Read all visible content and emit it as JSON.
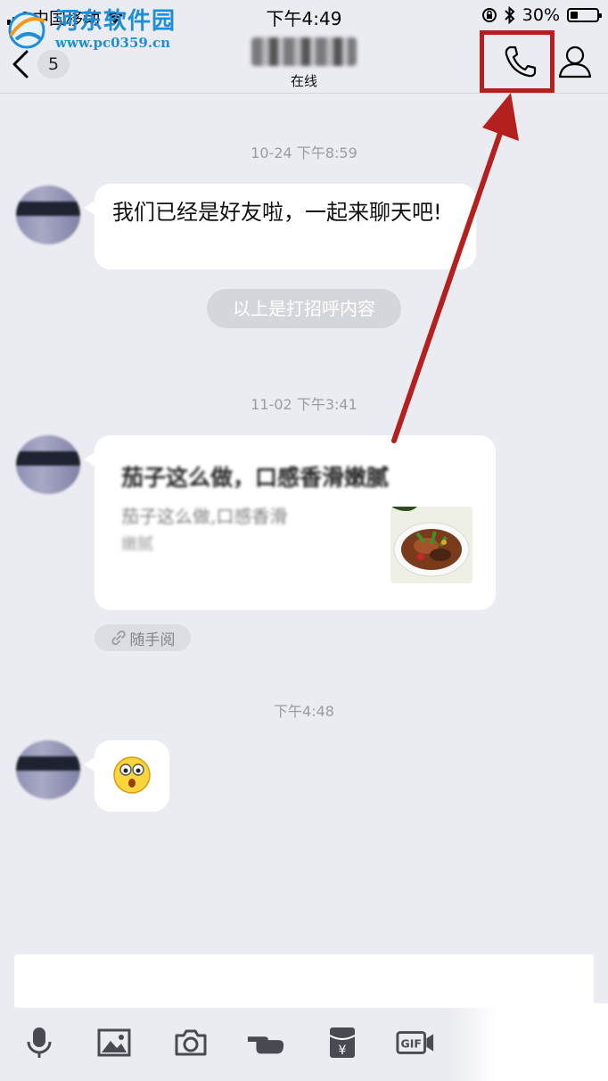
{
  "status_bar": {
    "carrier": "中国移动",
    "time": "下午4:49",
    "battery_percent": "30%",
    "battery_level": 0.3
  },
  "watermark": {
    "title": "河东软件园",
    "url": "www.pc0359.cn"
  },
  "nav": {
    "unread_count": "5",
    "subtitle": "在线",
    "highlight_color": "#b3201d"
  },
  "messages": {
    "t1": "10-24 下午8:59",
    "m1": "我们已经是好友啦，一起来聊天吧!",
    "notice": "以上是打招呼内容",
    "t2": "11-02 下午3:41",
    "link_title": "茄子这么做，口感香滑嫩腻",
    "link_desc": "茄子这么做,口感香滑",
    "link_desc2": "嫩腻",
    "source": "随手阅",
    "t3": "下午4:48"
  },
  "colors": {
    "background": "#ebecf1",
    "bubble": "#ffffff",
    "annotation_arrow": "#b3201d"
  }
}
